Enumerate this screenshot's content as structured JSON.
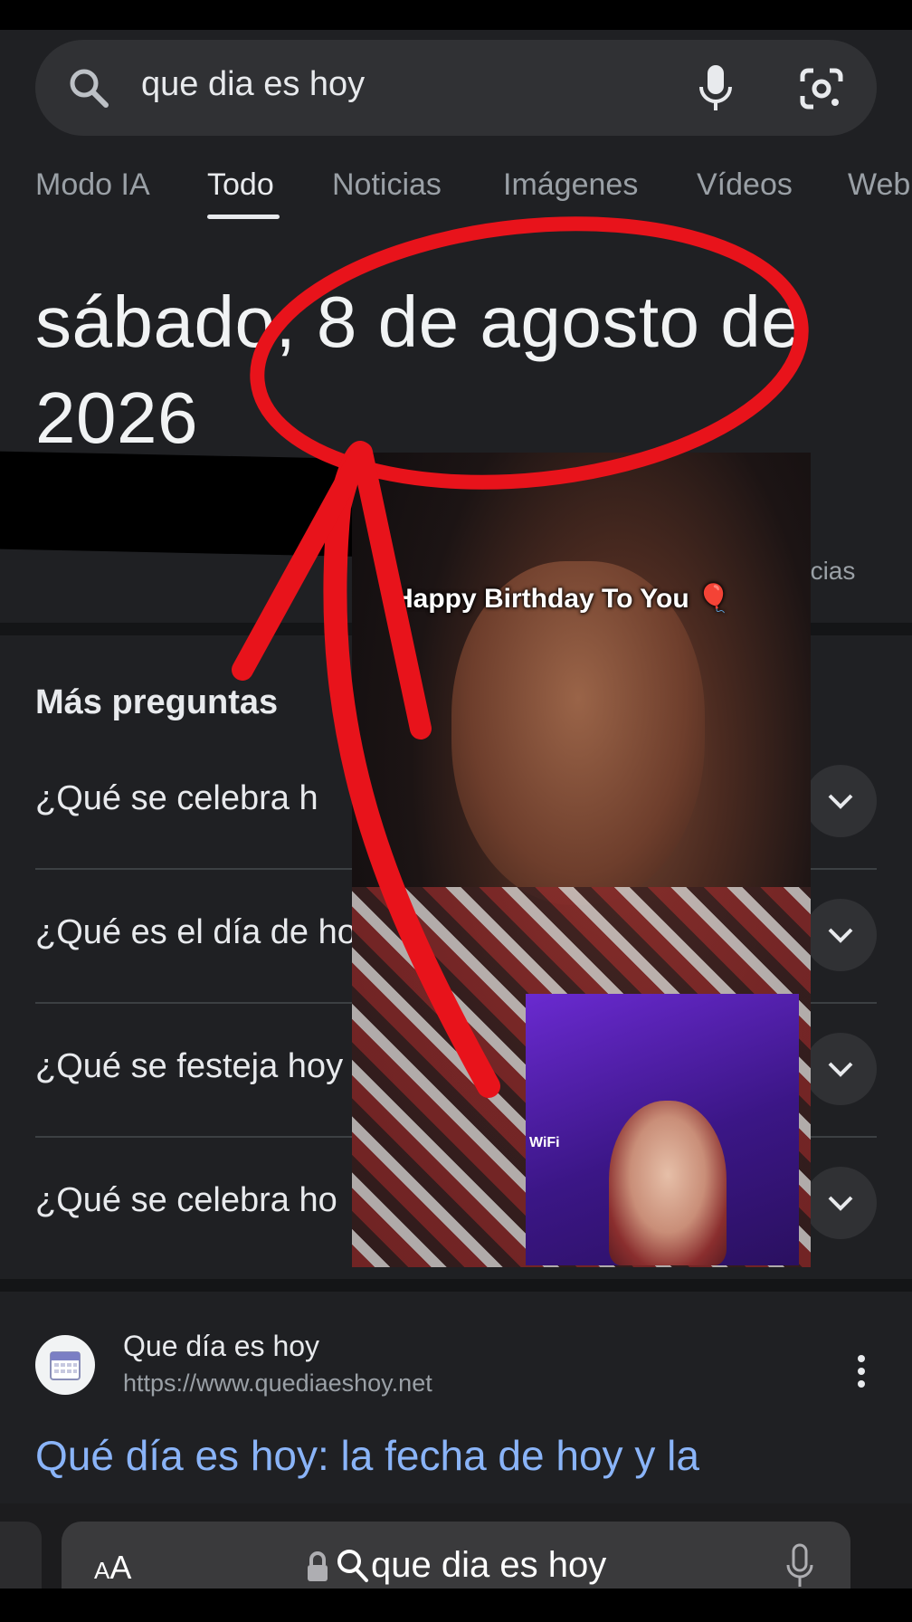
{
  "search": {
    "query": "que dia es hoy"
  },
  "tabs": [
    {
      "label": "Modo IA"
    },
    {
      "label": "Todo"
    },
    {
      "label": "Noticias"
    },
    {
      "label": "Imágenes"
    },
    {
      "label": "Vídeos"
    },
    {
      "label": "Web"
    }
  ],
  "answer": {
    "date_line1": "sábado, 8 de agosto de",
    "date_line2": "2026",
    "partial_text": "ncias"
  },
  "faq": {
    "title": "Más preguntas",
    "items": [
      {
        "q": "¿Qué se celebra h"
      },
      {
        "q": "¿Qué es el día de ho"
      },
      {
        "q": "¿Qué se festeja hoy"
      },
      {
        "q": "¿Qué se celebra ho"
      }
    ]
  },
  "result": {
    "site_name": "Que día es hoy",
    "site_url": "https://www.quediaeshoy.net",
    "title": "Qué día es hoy: la fecha de hoy y la"
  },
  "overlay": {
    "caption": "Happy Birthday To You 🎈",
    "inset_label": "WiFi"
  },
  "safari": {
    "aa_small": "A",
    "aa_large": "A",
    "url": "que dia es hoy"
  },
  "colors": {
    "background": "#1f2023",
    "link": "#8ab4f8",
    "annotation_red": "#e8131b"
  }
}
